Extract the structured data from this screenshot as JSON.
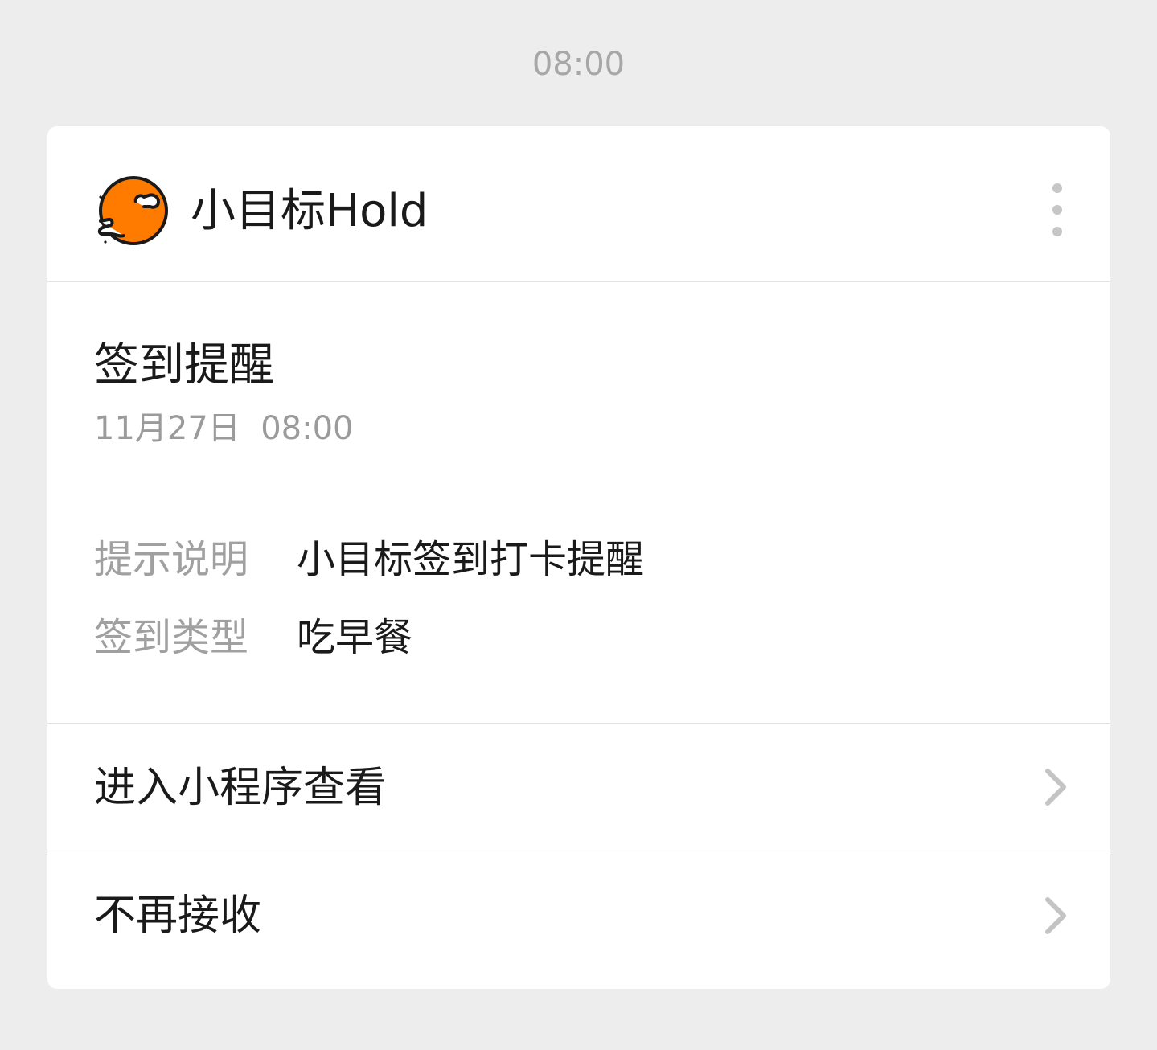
{
  "timestamp": "08:00",
  "card": {
    "app_name": "小目标Hold",
    "app_icon": "xiaomubiao-logo",
    "more_icon": "more-vertical-icon",
    "notice_title": "签到提醒",
    "notice_date": "11月27日",
    "notice_time": "08:00",
    "fields": [
      {
        "label": "提示说明",
        "value": "小目标签到打卡提醒"
      },
      {
        "label": "签到类型",
        "value": "吃早餐"
      }
    ],
    "actions": [
      {
        "label": "进入小程序查看",
        "icon": "chevron-right-icon"
      },
      {
        "label": "不再接收",
        "icon": "chevron-right-icon"
      }
    ]
  },
  "colors": {
    "background": "#ededed",
    "card": "#ffffff",
    "logo_orange": "#ff7b00",
    "muted_text": "#a0a0a0",
    "primary_text": "#1a1a1a"
  }
}
